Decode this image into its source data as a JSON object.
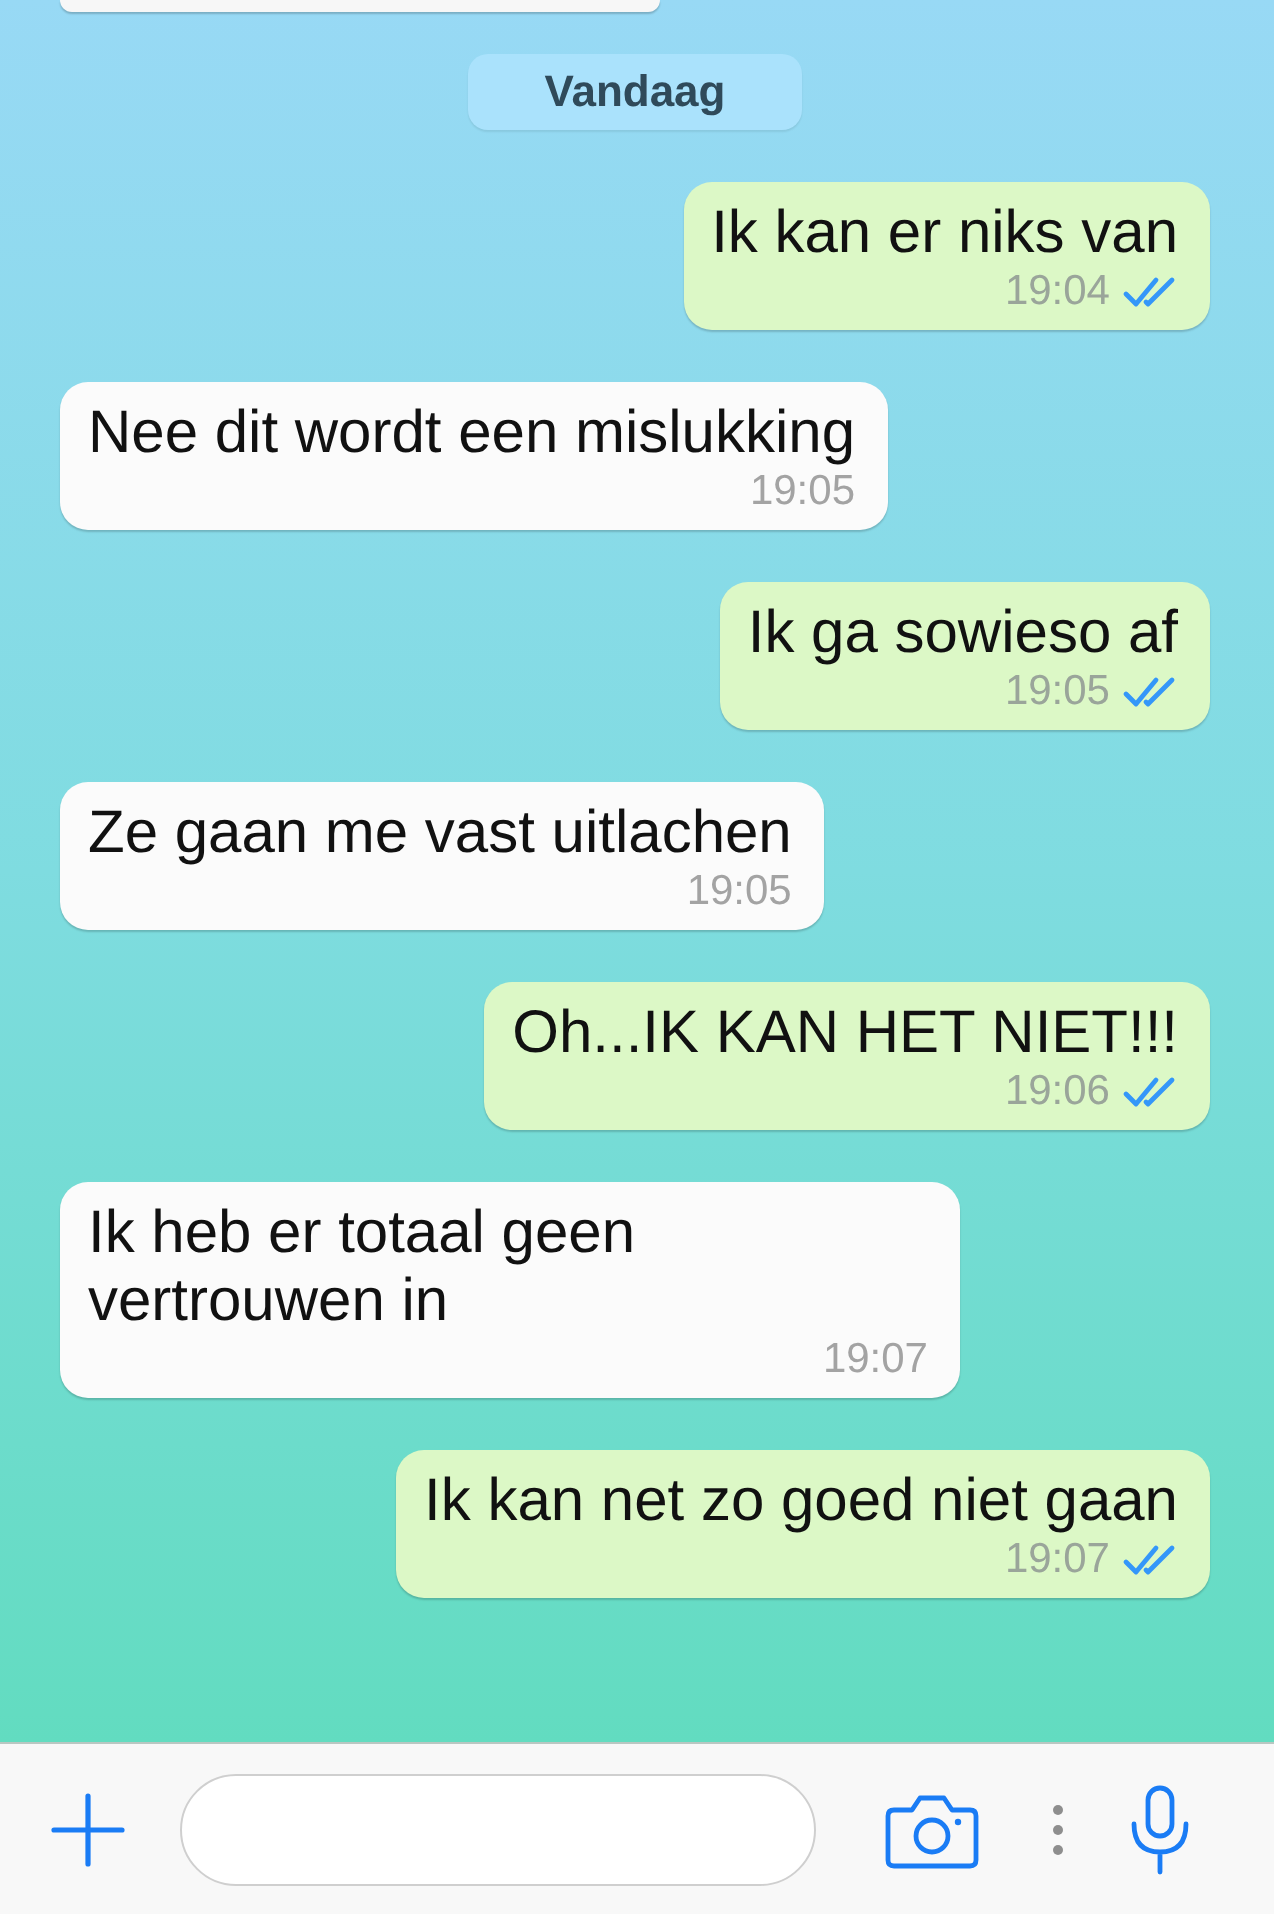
{
  "date_separator": "Vandaag",
  "messages": [
    {
      "kind": "outgoing",
      "text": "Ik kan er niks van",
      "time": "19:04",
      "read": true
    },
    {
      "kind": "incoming",
      "text": "Nee dit wordt een mislukking",
      "time": "19:05"
    },
    {
      "kind": "outgoing",
      "text": "Ik ga sowieso af",
      "time": "19:05",
      "read": true
    },
    {
      "kind": "incoming",
      "text": "Ze gaan me vast uitlachen",
      "time": "19:05"
    },
    {
      "kind": "outgoing",
      "text": "Oh...IK KAN HET NIET!!!",
      "time": "19:06",
      "read": true
    },
    {
      "kind": "incoming",
      "text": "Ik heb er totaal geen vertrouwen in",
      "time": "19:07"
    },
    {
      "kind": "outgoing",
      "text": "Ik kan net zo goed niet gaan",
      "time": "19:07",
      "read": true
    }
  ]
}
